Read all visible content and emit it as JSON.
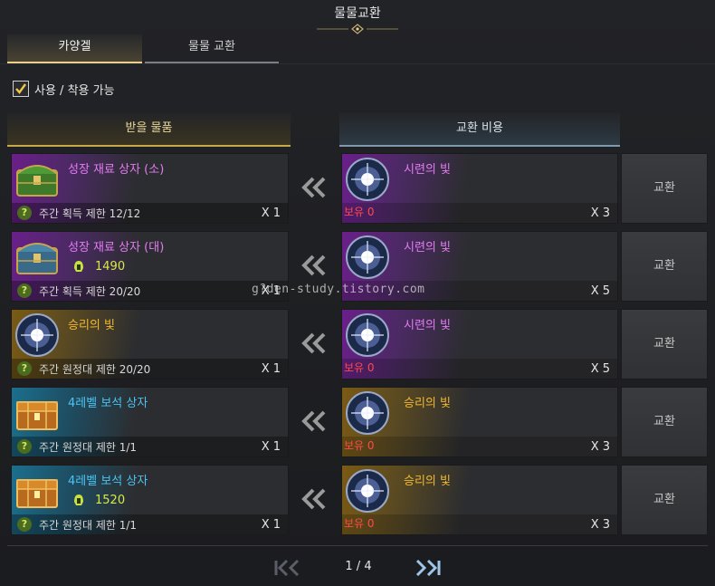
{
  "window": {
    "title": "물물교환"
  },
  "tabs": [
    {
      "label": "카양겔",
      "active": true
    },
    {
      "label": "물물 교환",
      "active": false
    }
  ],
  "filter": {
    "label": "사용 / 착용 가능",
    "checked": true
  },
  "columns": {
    "receive": "받을 물품",
    "cost": "교환 비용"
  },
  "rows": [
    {
      "receive": {
        "name": "성장 재료 상자 (소)",
        "icon": "green-chest-icon",
        "limit": "주간 획득 제한 12/12",
        "qty": "X 1",
        "price": ""
      },
      "cost": {
        "name": "시련의 빛",
        "icon": "light-orb-icon",
        "own": "보유 0",
        "qty": "X 3"
      },
      "button": "교환"
    },
    {
      "receive": {
        "name": "성장 재료 상자 (대)",
        "icon": "blue-chest-icon",
        "limit": "주간 획득 제한 20/20",
        "qty": "X 1",
        "price": "1490"
      },
      "cost": {
        "name": "시련의 빛",
        "icon": "light-orb-icon",
        "own": "",
        "qty": "X 5"
      },
      "button": "교환"
    },
    {
      "receive": {
        "name": "승리의 빛",
        "icon": "light-orb-icon",
        "limit": "주간 원정대 제한 20/20",
        "qty": "X 1",
        "price": ""
      },
      "cost": {
        "name": "시련의 빛",
        "icon": "light-orb-icon",
        "own": "보유 0",
        "qty": "X 5"
      },
      "button": "교환"
    },
    {
      "receive": {
        "name": "4레벨 보석 상자",
        "icon": "gem-chest-icon",
        "limit": "주간 원정대 제한 1/1",
        "qty": "X 1",
        "price": ""
      },
      "cost": {
        "name": "승리의 빛",
        "icon": "light-orb-icon",
        "own": "보유 0",
        "qty": "X 3"
      },
      "button": "교환"
    },
    {
      "receive": {
        "name": "4레벨 보석 상자",
        "icon": "gem-chest-icon",
        "limit": "주간 원정대 제한 1/1",
        "qty": "X 1",
        "price": "1520"
      },
      "cost": {
        "name": "승리의 빛",
        "icon": "light-orb-icon",
        "own": "보유 0",
        "qty": "X 3"
      },
      "button": "교환"
    }
  ],
  "pager": {
    "label": "1 / 4"
  },
  "watermark": "g?den-study.tistory.com",
  "colors": {
    "accent_gold": "#e8d08a",
    "purple": "#e37bf2",
    "gold": "#f0b830",
    "blue": "#4cc3f0",
    "price": "#d7e84a",
    "warning": "#ff4a4a"
  }
}
